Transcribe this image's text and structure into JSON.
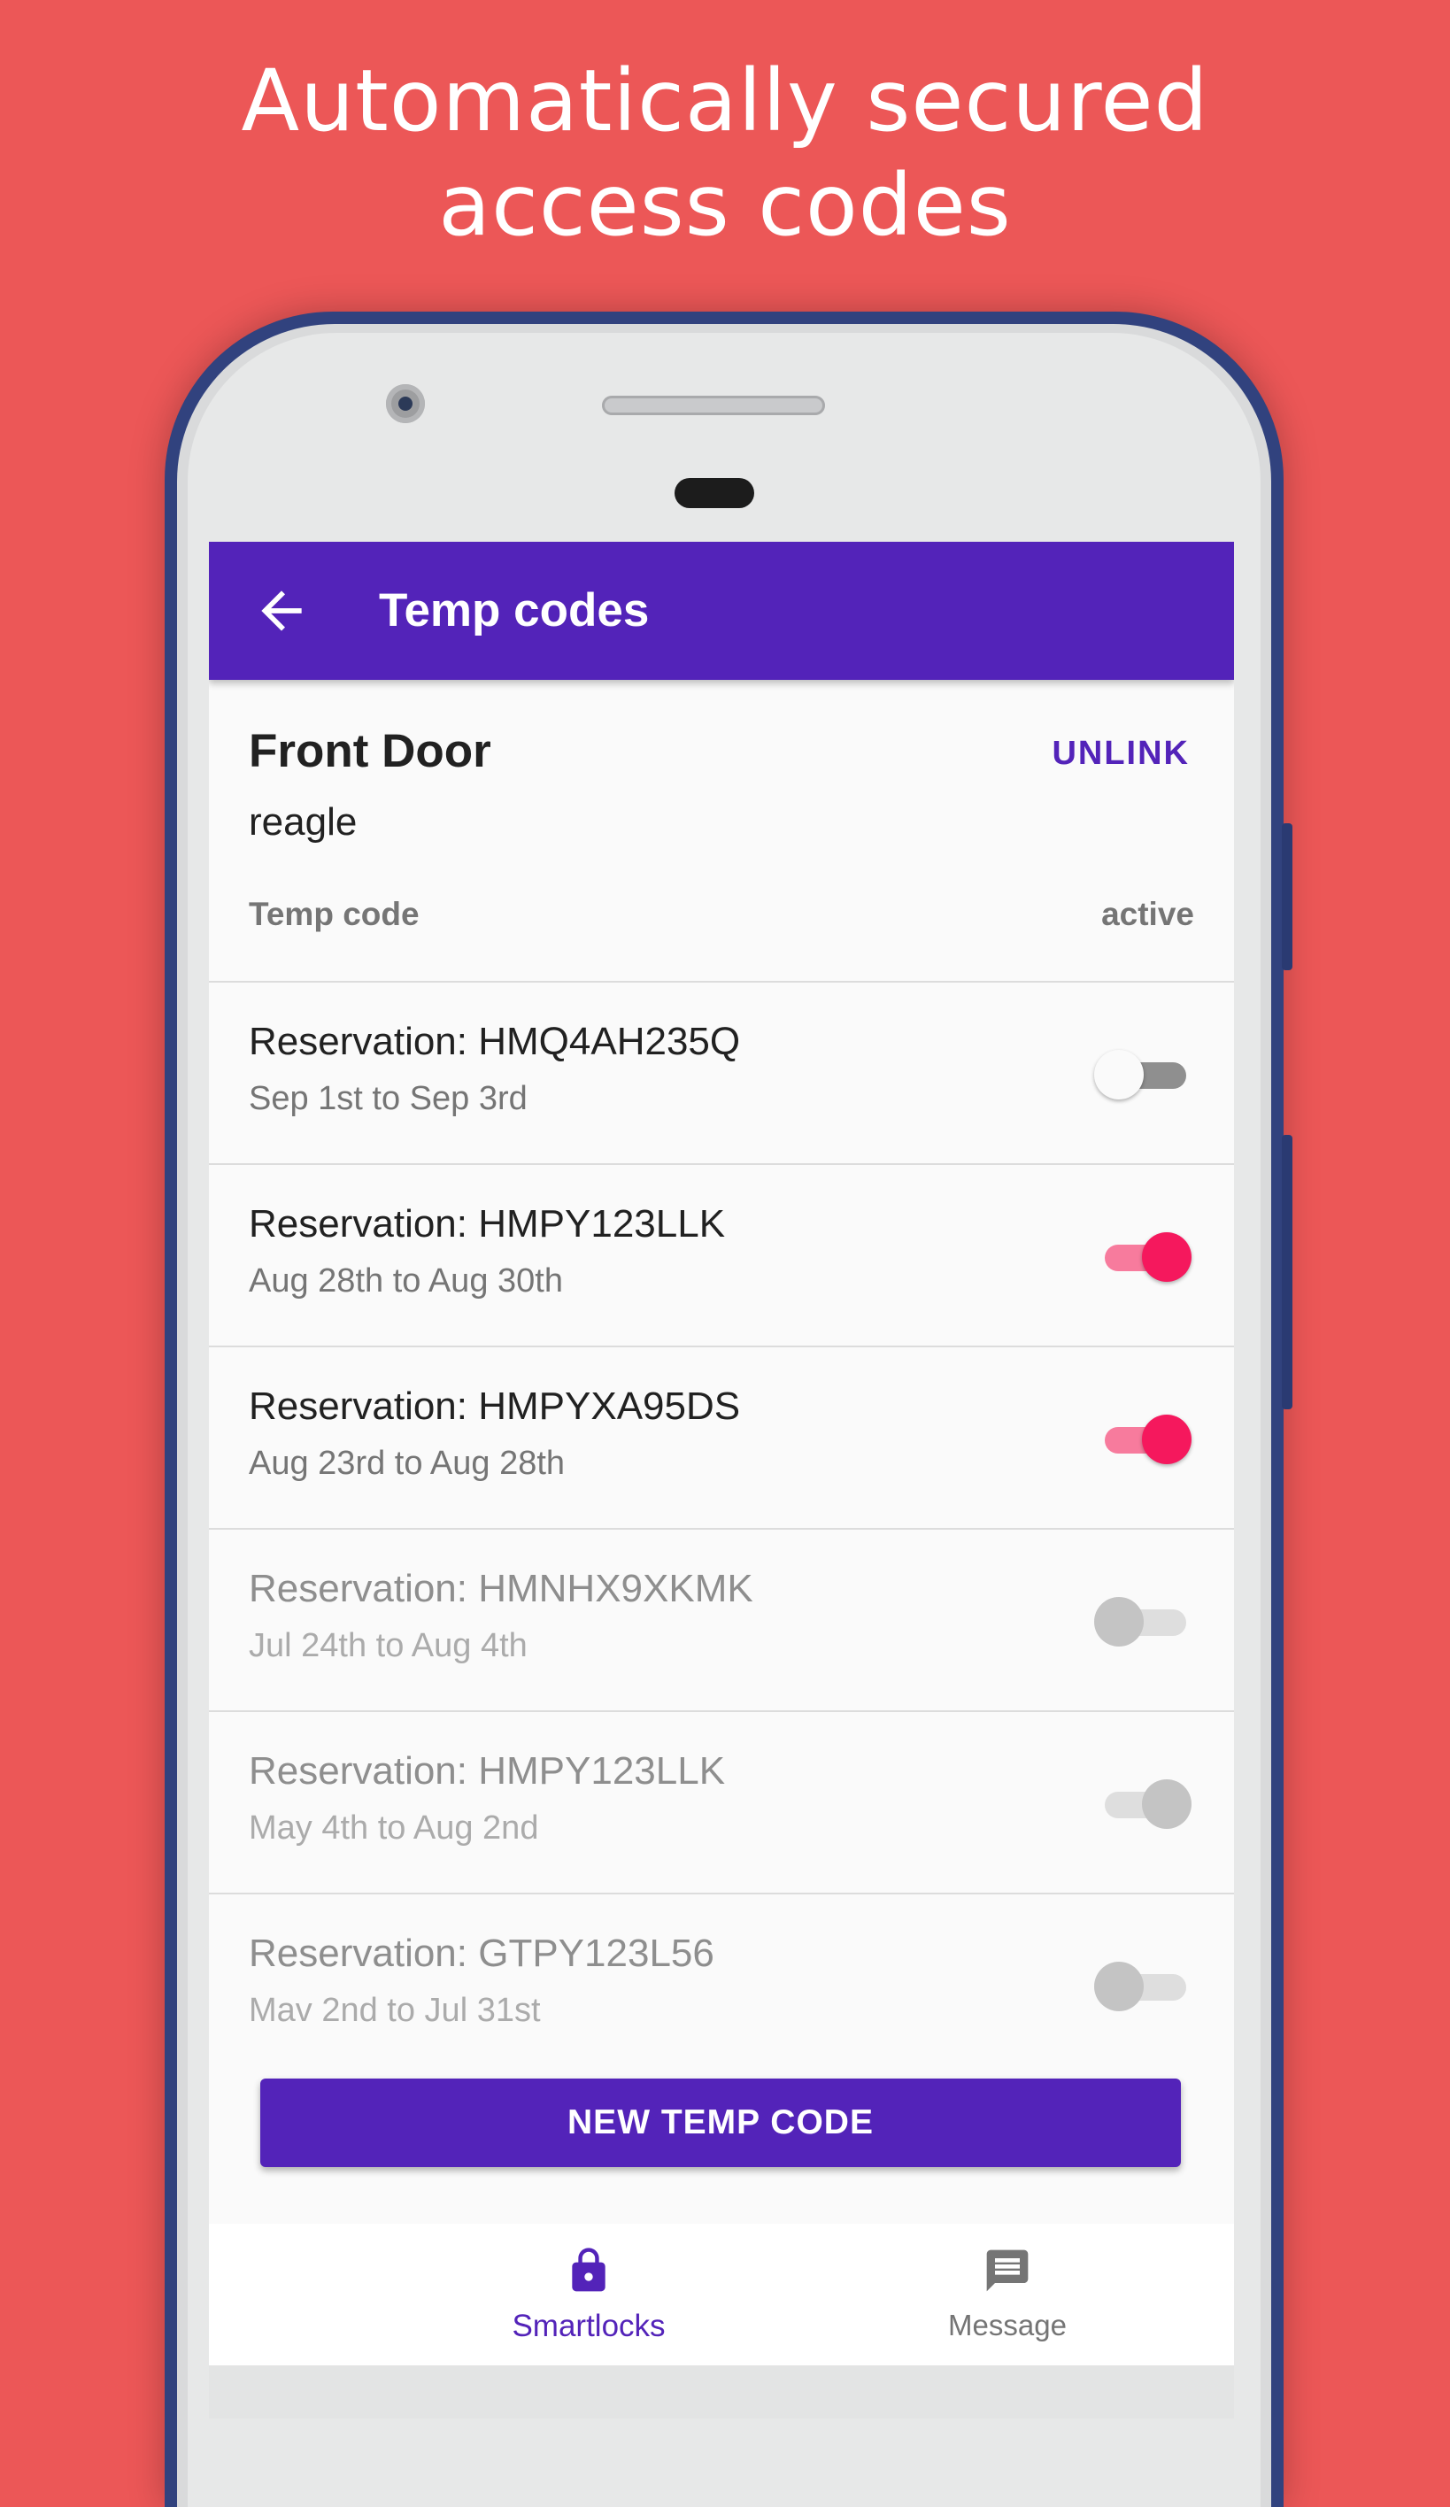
{
  "headline": {
    "line1": "Automatically secured",
    "line2": "access codes"
  },
  "appbar": {
    "back_icon": "arrow-left-icon",
    "title": "Temp codes"
  },
  "lock": {
    "name": "Front Door",
    "owner": "reagle",
    "unlink_label": "UNLINK"
  },
  "columns": {
    "code": "Temp code",
    "active": "active"
  },
  "codes": [
    {
      "title": "Reservation: HMQ4AH235Q",
      "dates": "Sep 1st to Sep 3rd",
      "active": false,
      "enabled": true
    },
    {
      "title": "Reservation: HMPY123LLK",
      "dates": "Aug 28th to Aug 30th",
      "active": true,
      "enabled": true
    },
    {
      "title": "Reservation: HMPYXA95DS",
      "dates": "Aug 23rd to Aug 28th",
      "active": true,
      "enabled": true
    },
    {
      "title": "Reservation: HMNHX9XKMK",
      "dates": "Jul 24th to Aug 4th",
      "active": false,
      "enabled": false
    },
    {
      "title": "Reservation: HMPY123LLK",
      "dates": "May 4th to Aug 2nd",
      "active": true,
      "enabled": false
    },
    {
      "title": "Reservation: GTPY123L56",
      "dates": "Mav 2nd to Jul 31st",
      "active": false,
      "enabled": false
    }
  ],
  "new_button_label": "NEW TEMP CODE",
  "bottom_nav": {
    "smartlocks": {
      "label": "Smartlocks",
      "icon": "lock-icon",
      "selected": true
    },
    "message": {
      "label": "Message",
      "icon": "message-icon",
      "selected": false
    }
  },
  "colors": {
    "background": "#ec5757",
    "primary": "#5323b9",
    "switch_on": "#f5185d",
    "phone_frame": "#31427e"
  }
}
